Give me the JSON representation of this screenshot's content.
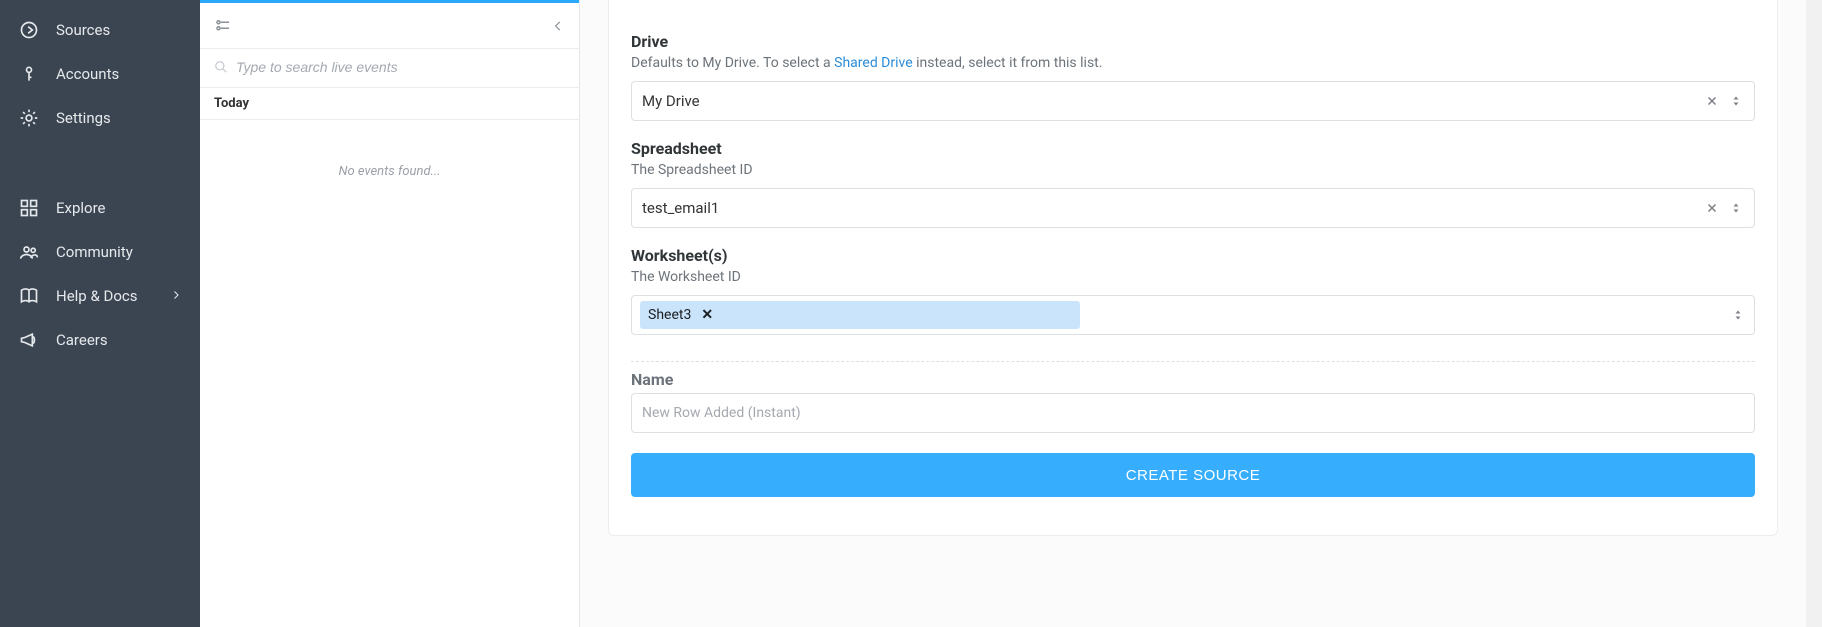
{
  "sidebar": {
    "items": [
      {
        "label": "Sources"
      },
      {
        "label": "Accounts"
      },
      {
        "label": "Settings"
      }
    ],
    "bottom": [
      {
        "label": "Explore"
      },
      {
        "label": "Community"
      },
      {
        "label": "Help & Docs"
      },
      {
        "label": "Careers"
      }
    ]
  },
  "events": {
    "search_placeholder": "Type to search live events",
    "today_label": "Today",
    "empty_text": "No events found..."
  },
  "form": {
    "drive": {
      "label": "Drive",
      "desc_prefix": "Defaults to My Drive. To select a ",
      "desc_link": "Shared Drive",
      "desc_suffix": " instead, select it from this list.",
      "value": "My Drive"
    },
    "spreadsheet": {
      "label": "Spreadsheet",
      "desc": "The Spreadsheet ID",
      "value": "test_email1"
    },
    "worksheet": {
      "label": "Worksheet(s)",
      "desc": "The Worksheet ID",
      "chip": "Sheet3"
    },
    "name": {
      "label": "Name",
      "placeholder": "New Row Added (Instant)"
    },
    "create_label": "CREATE SOURCE"
  }
}
